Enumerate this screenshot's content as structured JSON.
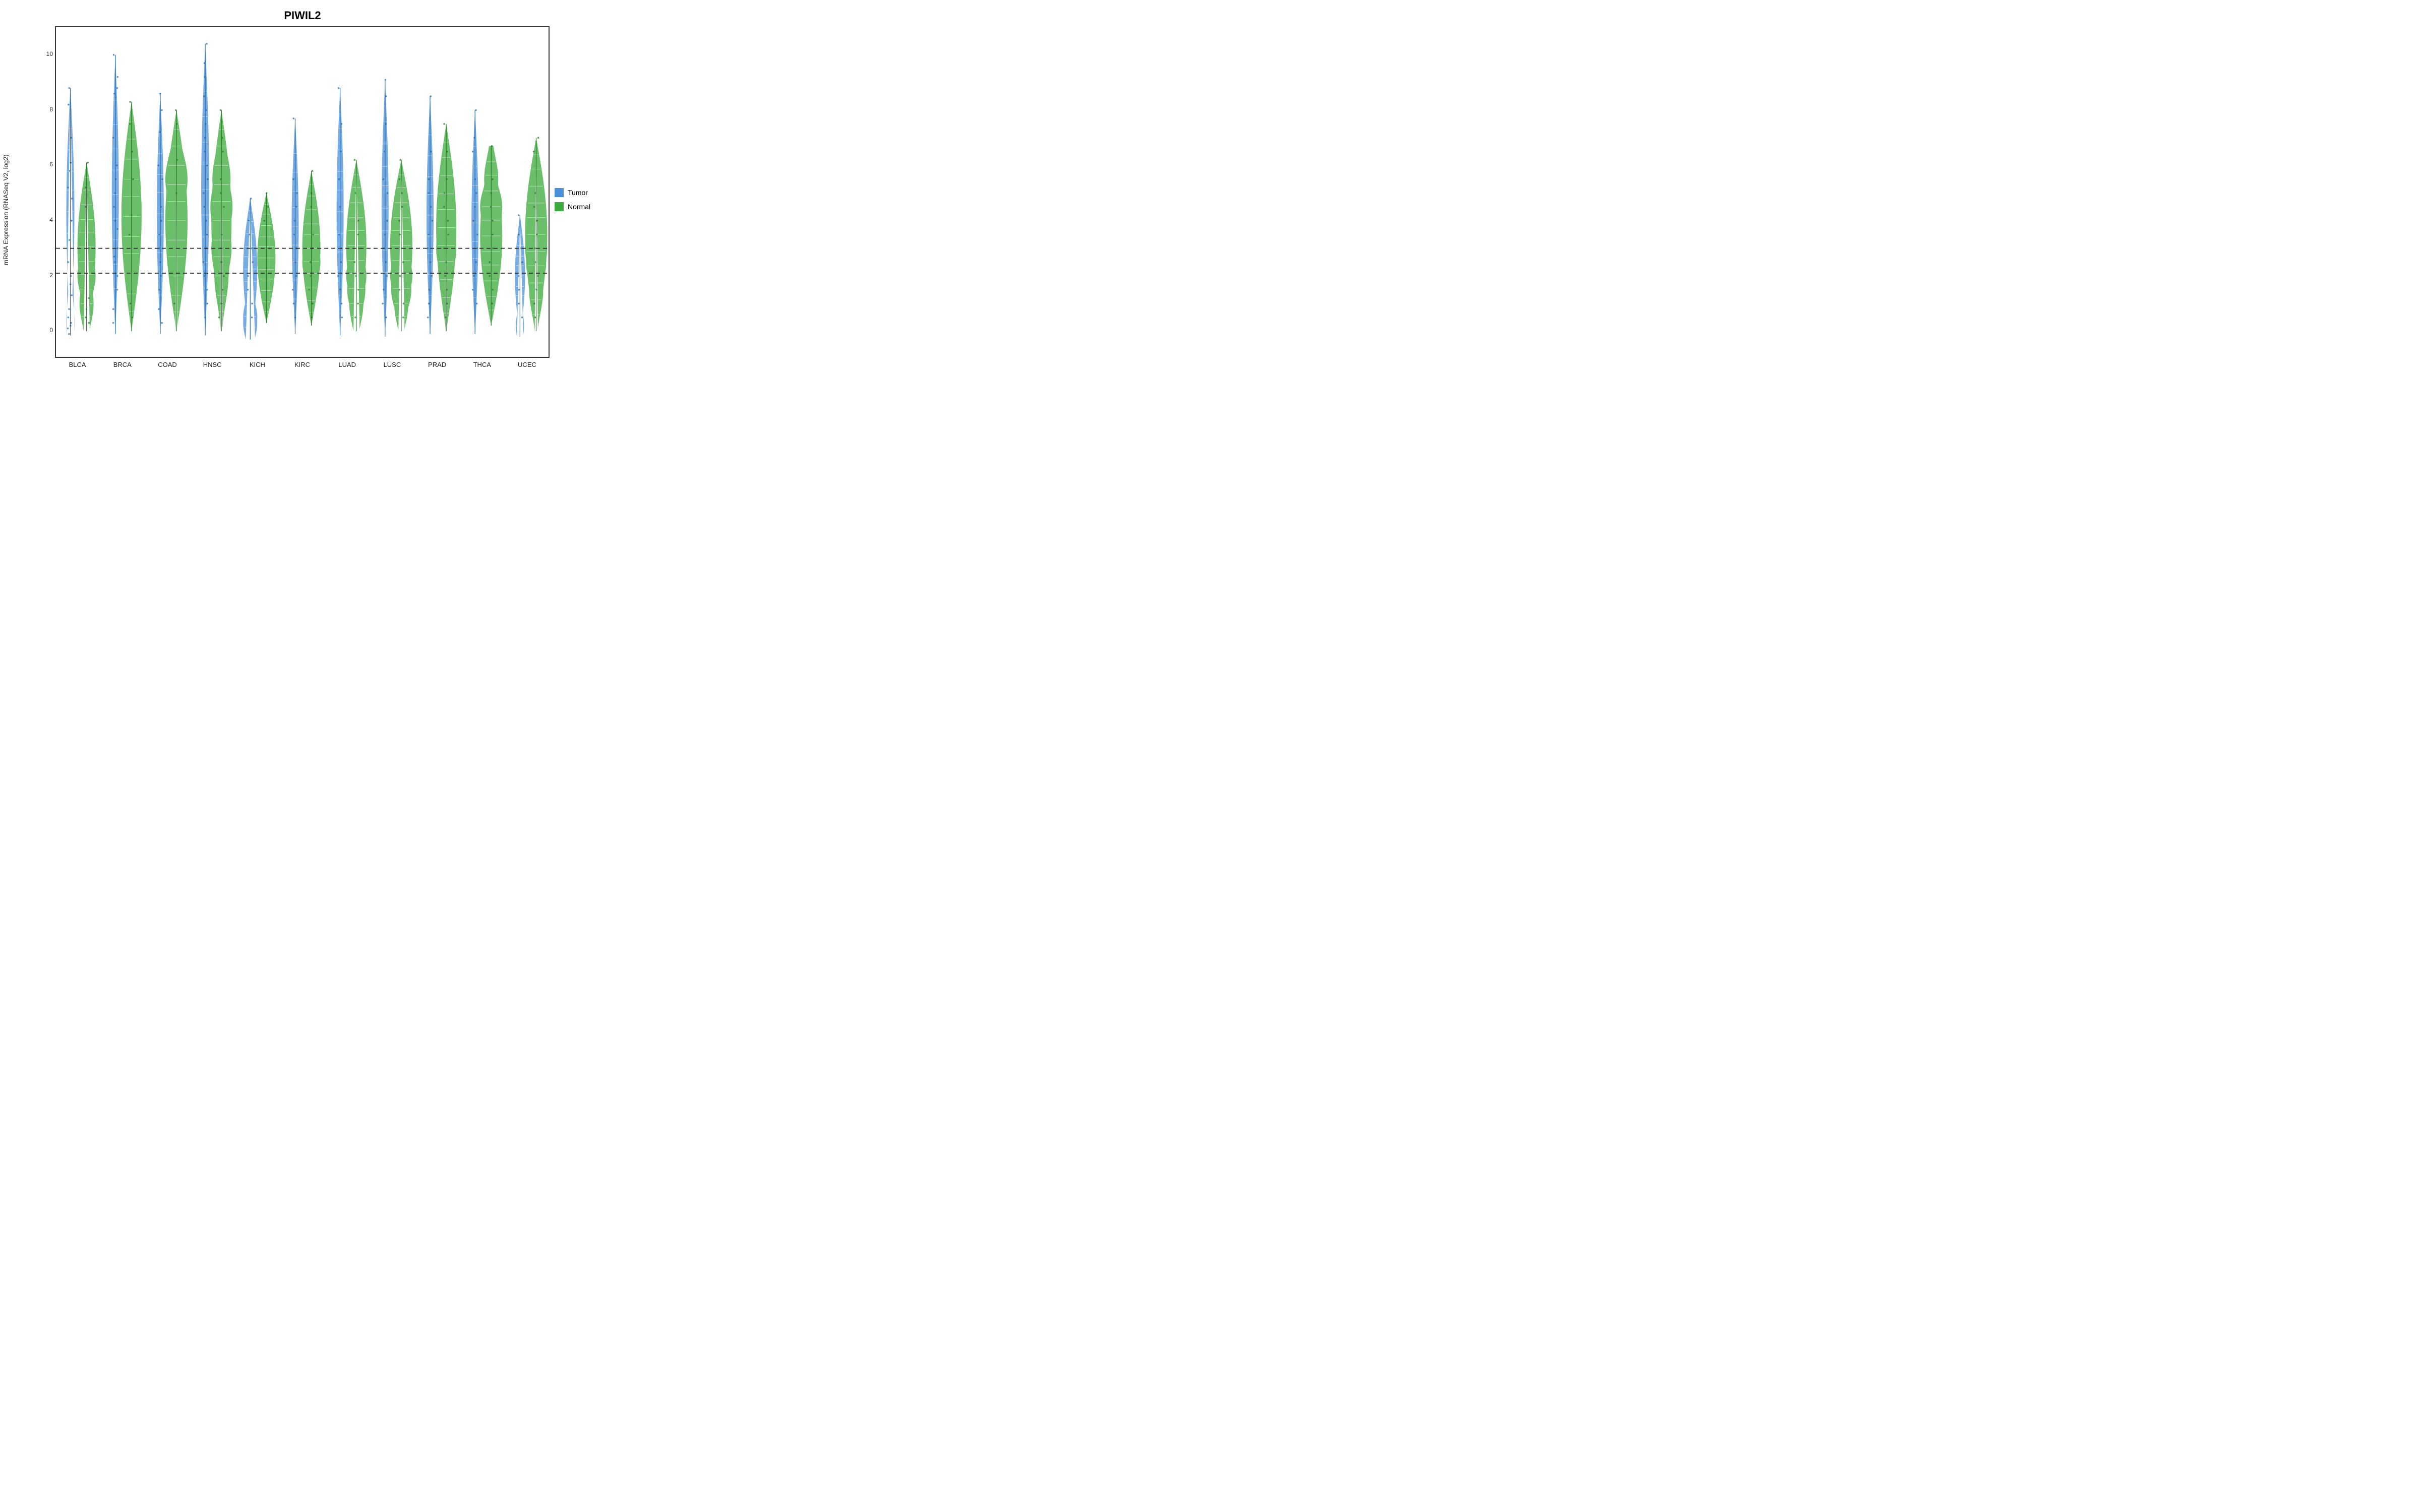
{
  "title": "PIWIL2",
  "yaxis_label": "mRNA Expression (RNASeq V2, log2)",
  "xaxis_labels": [
    "BLCA",
    "BRCA",
    "COAD",
    "HNSC",
    "KICH",
    "KIRC",
    "LUAD",
    "LUSC",
    "PRAD",
    "THCA",
    "UCEC"
  ],
  "legend": {
    "items": [
      {
        "label": "Tumor",
        "color": "#3a7bbf"
      },
      {
        "label": "Normal",
        "color": "#3aaa3a"
      }
    ]
  },
  "yaxis": {
    "min": -1,
    "max": 11,
    "ticks": [
      0,
      2,
      4,
      6,
      8,
      10
    ]
  },
  "dashed_lines": [
    2.1,
    3.0
  ],
  "colors": {
    "tumor": "#4a90d9",
    "normal": "#3aaa3a",
    "border": "#333333"
  }
}
